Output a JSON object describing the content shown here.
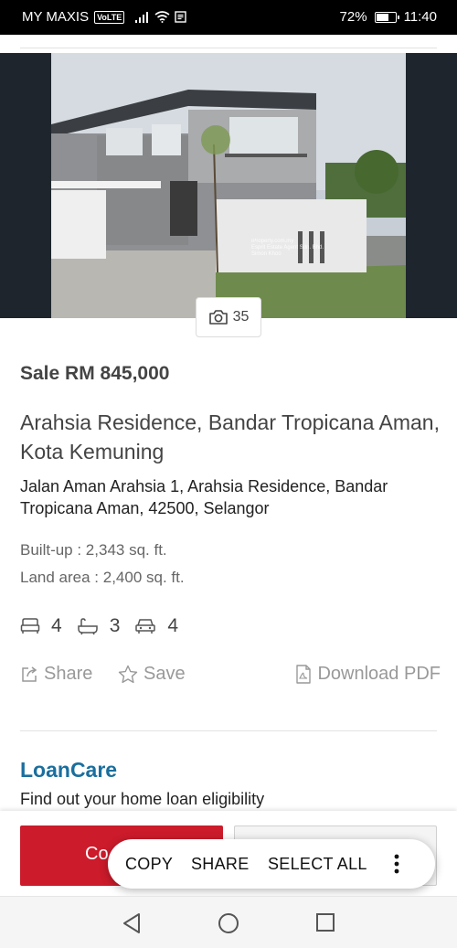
{
  "status_bar": {
    "carrier": "MY MAXIS",
    "volte": "VoLTE",
    "battery": "72%",
    "battery_level": 0.72,
    "time": "11:40"
  },
  "gallery": {
    "photo_count": "35",
    "watermark": [
      "iProperty.com.my",
      "Esprit Estate Agent Sdn. Bhd.",
      "Simon Khoo"
    ]
  },
  "listing": {
    "price": "Sale RM 845,000",
    "title": "Arahsia Residence, Bandar Tropicana Aman, Kota Kemuning",
    "address": "Jalan Aman Arahsia 1, Arahsia Residence, Bandar Tropicana Aman, 42500, Selangor",
    "built_up": "Built-up : 2,343 sq. ft.",
    "land_area": "Land area : 2,400 sq. ft.",
    "bedrooms": "4",
    "bathrooms": "3",
    "car_parks": "4"
  },
  "actions": {
    "share": "Share",
    "save": "Save",
    "download": "Download PDF"
  },
  "loancare": {
    "logo": "LoanCare",
    "tagline": "Find out your home loan eligibility"
  },
  "bottom_bar": {
    "primary_partial": "Co"
  },
  "context_menu": {
    "copy": "COPY",
    "share": "SHARE",
    "select_all": "SELECT ALL"
  },
  "colors": {
    "accent_red": "#cc1b2b",
    "loancare_blue": "#1a6f9e"
  }
}
